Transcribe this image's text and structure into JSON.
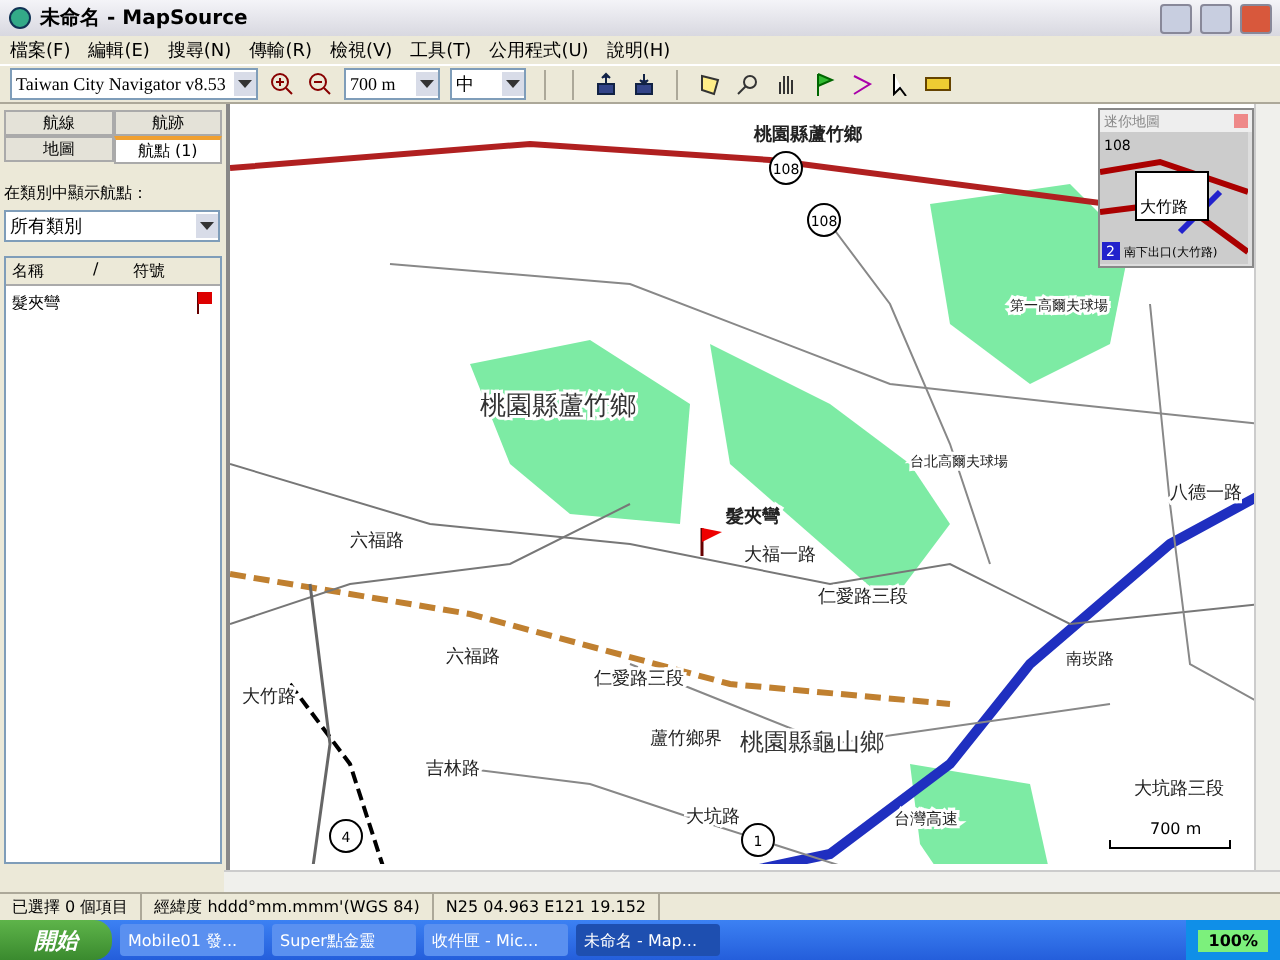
{
  "window": {
    "title": "未命名 - MapSource"
  },
  "menu": [
    "檔案(F)",
    "編輯(E)",
    "搜尋(N)",
    "傳輸(R)",
    "檢視(V)",
    "工具(T)",
    "公用程式(U)",
    "說明(H)"
  ],
  "toolbar": {
    "map_product": "Taiwan City Navigator v8.53",
    "zoom": "700 m",
    "detail": "中"
  },
  "tabs": [
    {
      "label": "航線",
      "selected": false
    },
    {
      "label": "航跡",
      "selected": false
    },
    {
      "label": "地圖",
      "selected": false
    },
    {
      "label": "航點 (1)",
      "selected": true
    }
  ],
  "panel": {
    "filter_label": "在類別中顯示航點：",
    "category": "所有類別",
    "columns": [
      "名稱",
      "/",
      "符號"
    ],
    "waypoints": [
      {
        "name": "髮夾彎",
        "selected": false
      }
    ]
  },
  "map": {
    "labels": [
      {
        "text": "桃園縣蘆竹鄉",
        "kind": "boxed"
      },
      {
        "text": "桃園縣蘆竹鄉",
        "kind": "area"
      },
      {
        "text": "第一高爾夫球場",
        "kind": "poi"
      },
      {
        "text": "台北高爾夫球場",
        "kind": "poi"
      },
      {
        "text": "髮夾彎",
        "kind": "waypoint"
      },
      {
        "text": "六福路",
        "kind": "road"
      },
      {
        "text": "大福一路",
        "kind": "road"
      },
      {
        "text": "仁愛路三段",
        "kind": "road"
      },
      {
        "text": "仁愛路三段",
        "kind": "road"
      },
      {
        "text": "大竹路",
        "kind": "road"
      },
      {
        "text": "八德一路",
        "kind": "road"
      },
      {
        "text": "南崁路",
        "kind": "road"
      },
      {
        "text": "蘆竹鄉界",
        "kind": "road"
      },
      {
        "text": "桃園縣龜山鄉",
        "kind": "area"
      },
      {
        "text": "大坑路",
        "kind": "road"
      },
      {
        "text": "大坑路三段",
        "kind": "road"
      },
      {
        "text": "台灣高速",
        "kind": "road"
      },
      {
        "text": "六福路",
        "kind": "road"
      },
      {
        "text": "吉林路",
        "kind": "road"
      }
    ],
    "shields": [
      "108",
      "108",
      "4",
      "1"
    ],
    "scale": "700 m",
    "minimap": {
      "title": "迷你地圖",
      "labels": [
        "108",
        "大竹路",
        "2",
        "南下出口(大竹路)"
      ]
    }
  },
  "status": [
    "已選擇 0 個項目",
    "經緯度 hddd°mm.mmm'(WGS 84)",
    "N25 04.963 E121 19.152"
  ],
  "taskbar": {
    "start": "開始",
    "tasks": [
      {
        "label": "Mobile01 發...",
        "selected": false
      },
      {
        "label": "Super點金靈",
        "selected": false
      },
      {
        "label": "收件匣 - Mic...",
        "selected": false
      },
      {
        "label": "未命名 - Map...",
        "selected": true
      }
    ],
    "battery": "100%"
  }
}
